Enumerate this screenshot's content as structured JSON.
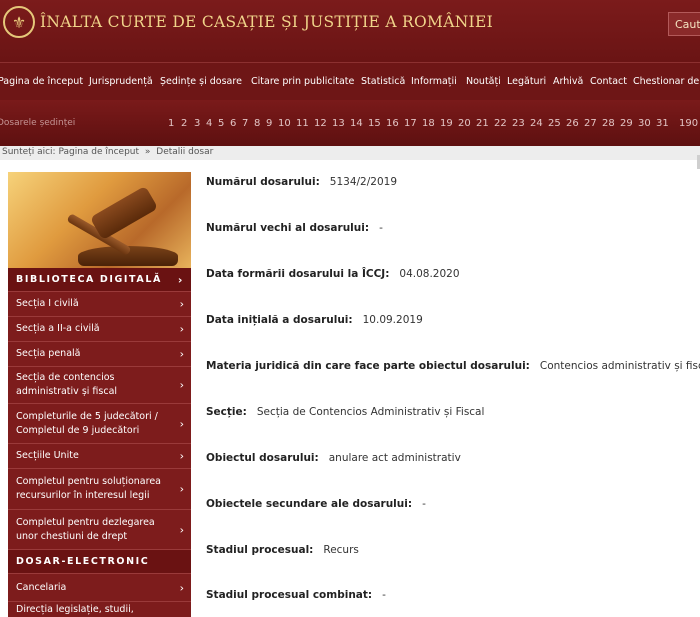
{
  "header": {
    "title": "ÎNALTA CURTE DE CASAȚIE ȘI JUSTIȚIE A ROMÂNIEI",
    "search_label": "Cauta",
    "logo_icon": "coat-of-arms-icon"
  },
  "nav": {
    "items": [
      "Pagina de început",
      "Jurisprudență",
      "Ședințe și dosare",
      "Citare prin publicitate",
      "Statistică",
      "Informații",
      "Noutăți",
      "Legături",
      "Arhivă",
      "Contact",
      "Chestionar de"
    ]
  },
  "pager": {
    "label": "Dosarele ședinței",
    "pages": [
      "1",
      "2",
      "3",
      "4",
      "5",
      "6",
      "7",
      "8",
      "9",
      "10",
      "11",
      "12",
      "13",
      "14",
      "15",
      "16",
      "17",
      "18",
      "19",
      "20",
      "21",
      "22",
      "23",
      "24",
      "25",
      "26",
      "27",
      "28",
      "29",
      "30",
      "31",
      "190"
    ]
  },
  "breadcrumb": {
    "prefix": "Sunteți aici:",
    "home": "Pagina de început",
    "separator": "»",
    "current": "Detalii dosar"
  },
  "sidebar": {
    "items": [
      {
        "label": "BIBLIOTECA DIGITALĂ",
        "header": true
      },
      {
        "label": "Secția I civilă"
      },
      {
        "label": "Secția a II-a civilă"
      },
      {
        "label": "Secția penală"
      },
      {
        "label": "Secția de contencios administrativ și fiscal"
      },
      {
        "label": "Completurile de 5 judecători / Completul de 9 judecători"
      },
      {
        "label": "Secțiile Unite"
      },
      {
        "label": "Completul pentru soluționarea recursurilor în interesul legii"
      },
      {
        "label": "Completul pentru dezlegarea unor chestiuni de drept"
      },
      {
        "label": "DOSAR-ELECTRONIC",
        "header": true
      },
      {
        "label": "Cancelaria"
      },
      {
        "label": "Direcția legislație, studii,"
      }
    ]
  },
  "dosar": {
    "fields": [
      {
        "label": "Numărul dosarului:",
        "value": "5134/2/2019"
      },
      {
        "label": "Numărul vechi al dosarului:",
        "value": "-"
      },
      {
        "label": "Data formării dosarului la ÎCCJ:",
        "value": "04.08.2020"
      },
      {
        "label": "Data inițială a dosarului:",
        "value": "10.09.2019"
      },
      {
        "label": "Materia juridică din care face parte obiectul dosarului:",
        "value": "Contencios administrativ și fiscal"
      },
      {
        "label": "Secție:",
        "value": "Secția de Contencios Administrativ și Fiscal"
      },
      {
        "label": "Obiectul dosarului:",
        "value": "anulare act administrativ"
      },
      {
        "label": "Obiectele secundare ale dosarului:",
        "value": "-"
      },
      {
        "label": "Stadiul procesual:",
        "value": "Recurs"
      },
      {
        "label": "Stadiul procesual combinat:",
        "value": "-"
      }
    ]
  }
}
